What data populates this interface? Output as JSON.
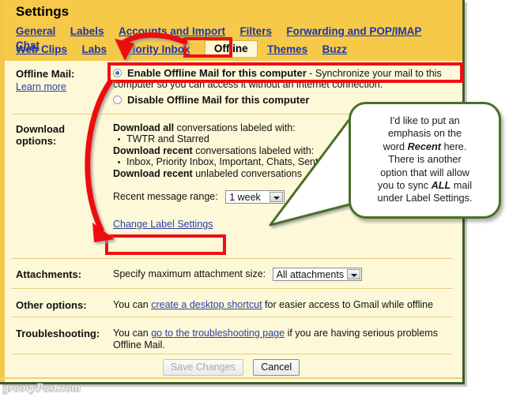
{
  "window": {
    "title": "Settings",
    "watermark": "groovyPost.com"
  },
  "tabs_row1": [
    {
      "label": "General",
      "selected": false
    },
    {
      "label": "Labels",
      "selected": false
    },
    {
      "label": "Accounts and Import",
      "selected": false
    },
    {
      "label": "Filters",
      "selected": false
    },
    {
      "label": "Forwarding and POP/IMAP",
      "selected": false
    },
    {
      "label": "Chat",
      "selected": false
    }
  ],
  "tabs_row2": [
    {
      "label": "Web Clips",
      "selected": false
    },
    {
      "label": "Labs",
      "selected": false
    },
    {
      "label": "Priority Inbox",
      "selected": false
    },
    {
      "label": "Offline",
      "selected": true
    },
    {
      "label": "Themes",
      "selected": false
    },
    {
      "label": "Buzz",
      "selected": false
    }
  ],
  "sections": {
    "offline_mail": {
      "label": "Offline Mail:",
      "learn_more": "Learn more",
      "enable": {
        "bold": "Enable Offline Mail for this computer",
        "desc": " - Synchronize your mail to this computer so you can access it without an internet connection.",
        "checked": true
      },
      "disable": {
        "bold": "Disable Offline Mail for this computer",
        "checked": false
      }
    },
    "download_options": {
      "label_line1": "Download",
      "label_line2": "options:",
      "heading_all_bold": "Download all",
      "heading_all_rest": " conversations labeled with:",
      "all_labels": "TWTR and Starred",
      "heading_recent_bold": "Download recent",
      "heading_recent_rest": " conversations labeled with:",
      "recent_labels": "Inbox, Priority Inbox, Important, Chats, Sent Mail, mail and SU.PR",
      "heading_unlabeled_bold": "Download recent",
      "heading_unlabeled_rest": " unlabeled conversations",
      "range_label": "Recent message range:",
      "range_value": "1 week",
      "change_label_settings": "Change Label Settings"
    },
    "attachments": {
      "label": "Attachments:",
      "text": "Specify maximum attachment size:",
      "value": "All attachments"
    },
    "other_options": {
      "label": "Other options:",
      "pre": "You can ",
      "link": "create a desktop shortcut",
      "post": " for easier access to Gmail while offline"
    },
    "troubleshooting": {
      "label": "Troubleshooting:",
      "pre": "You can ",
      "link": "go to the troubleshooting page",
      "post": " if you are having serious problems",
      "line2": "Offline Mail."
    }
  },
  "buttons": {
    "save": "Save Changes",
    "cancel": "Cancel"
  },
  "callout": {
    "line1": "I'd like to put an",
    "line2": "emphasis on the",
    "line3_pre": "word ",
    "line3_em": "Recent",
    "line3_post": " here.",
    "line4": "There is another",
    "line5": "option that will allow",
    "line6_pre": "you to sync ",
    "line6_em": "ALL",
    "line6_post": " mail",
    "line7": "under Label Settings."
  },
  "colors": {
    "header_gold": "#f6c949",
    "page_cream": "#fdf8d8",
    "link_blue": "#2b3fa8",
    "annotation_red": "#ee1111",
    "callout_green": "#4a7028",
    "frame_green": "#3c5c28"
  }
}
